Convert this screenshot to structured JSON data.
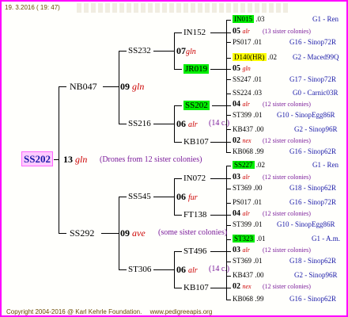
{
  "header": {
    "date": "19.  3.2016 ( 19: 47)",
    "watermark": "pedigreeapis.org"
  },
  "root": {
    "id": "SS202",
    "num": "13",
    "race": "gln",
    "note": "(Drones from 12 sister colonies)"
  },
  "g1": [
    {
      "id": "NB047",
      "num": "09",
      "race": "gln",
      "note": ""
    },
    {
      "id": "SS292",
      "num": "09",
      "race": "ave",
      "note": "(some sister colonies)"
    }
  ],
  "g2": [
    {
      "id": "SS232",
      "num": "07",
      "race": "gln",
      "note": ""
    },
    {
      "id": "SS216",
      "num": "06",
      "race": "alr",
      "note": "(14 c.)"
    },
    {
      "id": "SS545",
      "num": "06",
      "race": "fur",
      "note": ""
    },
    {
      "id": "ST306",
      "num": "06",
      "race": "alr",
      "note": "(14 c.)"
    }
  ],
  "g3": [
    {
      "id": "IN152"
    },
    {
      "id": "JR019"
    },
    {
      "id": "SS202"
    },
    {
      "id": "KB107"
    },
    {
      "id": "IN072"
    },
    {
      "id": "FT138"
    },
    {
      "id": "ST496"
    },
    {
      "id": "KB107"
    }
  ],
  "g4": [
    {
      "id": "IN015",
      "year": ".03",
      "info": "G1 - Ren"
    },
    {
      "num": "05",
      "race": "alr",
      "note": "(13 sister colonies)"
    },
    {
      "id": "PS017",
      "year": ".01",
      "info": "G16 - Sinop72R"
    },
    {
      "id": "D140(HR)",
      "year": ".02",
      "info": "G2 - Maced99Q"
    },
    {
      "num": "05",
      "race": "gln",
      "note": ""
    },
    {
      "id": "SS247",
      "year": ".01",
      "info": "G17 - Sinop72R"
    },
    {
      "id": "SS224",
      "year": ".03",
      "info": "G0 - Carnic03R"
    },
    {
      "num": "04",
      "race": "alr",
      "note": "(12 sister colonies)"
    },
    {
      "id": "ST399",
      "year": ".01",
      "info": "G10 - SinopEgg86R"
    },
    {
      "id": "KB437",
      "year": ".00",
      "info": "G2 - Sinop96R"
    },
    {
      "num": "02",
      "race": "nex",
      "note": "(12 sister colonies)"
    },
    {
      "id": "KB068",
      "year": ".99",
      "info": "G16 - Sinop62R"
    },
    {
      "id": "SS227",
      "year": ".02",
      "info": "G1 - Ren"
    },
    {
      "num": "03",
      "race": "alr",
      "note": "(12 sister colonies)"
    },
    {
      "id": "ST369",
      "year": ".00",
      "info": "G18 - Sinop62R"
    },
    {
      "id": "PS017",
      "year": ".01",
      "info": "G16 - Sinop72R"
    },
    {
      "num": "04",
      "race": "alr",
      "note": "(12 sister colonies)"
    },
    {
      "id": "ST399",
      "year": ".01",
      "info": "G10 - SinopEgg86R"
    },
    {
      "id": "ST323",
      "year": ".01",
      "info": "G1 - A.m."
    },
    {
      "num": "03",
      "race": "alr",
      "note": "(12 sister colonies)"
    },
    {
      "id": "ST369",
      "year": ".01",
      "info": "G18 - Sinop62R"
    },
    {
      "id": "KB437",
      "year": ".00",
      "info": "G2 - Sinop96R"
    },
    {
      "num": "02",
      "race": "nex",
      "note": "(12 sister colonies)"
    },
    {
      "id": "KB068",
      "year": ".99",
      "info": "G16 - Sinop62R"
    }
  ],
  "footer": {
    "copyright": "Copyright 2004-2016 @ Karl Kehrle Foundation.",
    "site": "www.pedigreeapis.org"
  }
}
